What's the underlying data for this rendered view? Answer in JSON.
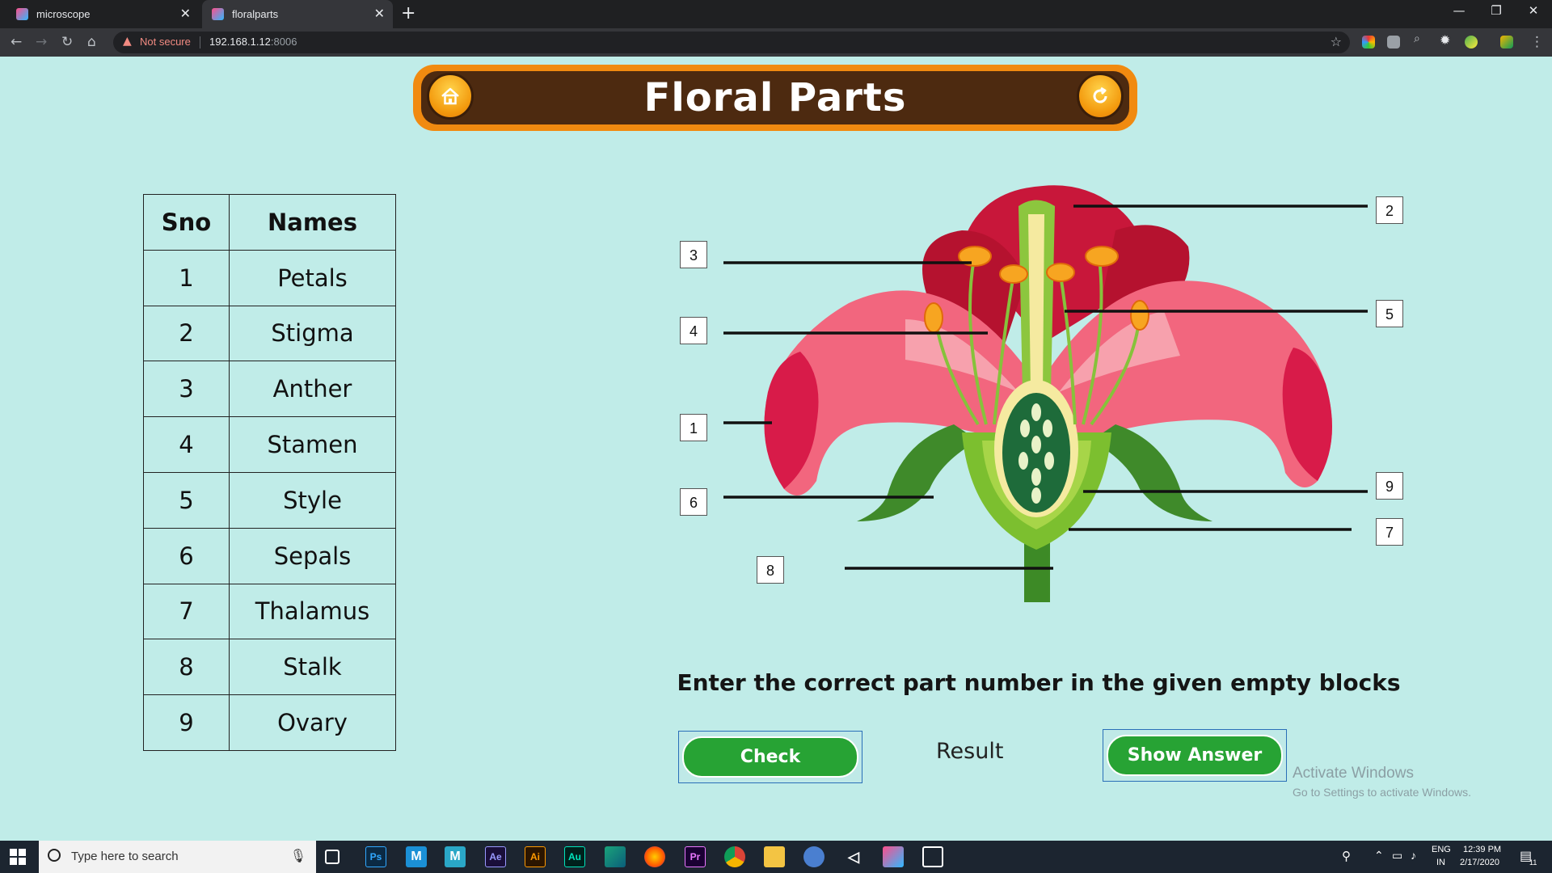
{
  "browser": {
    "tabs": [
      {
        "title": "microscope",
        "active": false
      },
      {
        "title": "floralparts",
        "active": true
      }
    ],
    "security_label": "Not secure",
    "url_host": "192.168.1.12",
    "url_port": ":8006"
  },
  "page": {
    "title": "Floral Parts",
    "table": {
      "headers": [
        "Sno",
        "Names"
      ],
      "rows": [
        [
          "1",
          "Petals"
        ],
        [
          "2",
          "Stigma"
        ],
        [
          "3",
          "Anther"
        ],
        [
          "4",
          "Stamen"
        ],
        [
          "5",
          "Style"
        ],
        [
          "6",
          "Sepals"
        ],
        [
          "7",
          "Thalamus"
        ],
        [
          "8",
          "Stalk"
        ],
        [
          "9",
          "Ovary"
        ]
      ]
    },
    "diagram_labels": [
      "2",
      "3",
      "5",
      "4",
      "1",
      "9",
      "6",
      "7",
      "8"
    ],
    "instruction": "Enter the correct part number in the given empty blocks",
    "check_label": "Check",
    "result_label": "Result",
    "show_answer_label": "Show Answer"
  },
  "watermark": {
    "line1": "Activate Windows",
    "line2": "Go to Settings to activate Windows."
  },
  "taskbar": {
    "search_placeholder": "Type here to search",
    "apps": [
      "task-view",
      "photoshop",
      "m-app-1",
      "m-app-2",
      "after-effects",
      "illustrator",
      "audition",
      "app-green",
      "firefox",
      "premiere",
      "chrome",
      "file-explorer",
      "chromium",
      "unity",
      "app-blue",
      "photos"
    ],
    "lang_top": "ENG",
    "lang_bottom": "IN",
    "time": "12:39 PM",
    "date": "2/17/2020",
    "notification_count": "11"
  },
  "colors": {
    "page_bg": "#c0ece8",
    "banner_orange": "#f18a10",
    "banner_brown": "#4d2a10",
    "button_green": "#27a334"
  }
}
